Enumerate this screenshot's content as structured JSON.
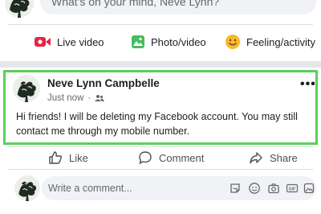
{
  "composer": {
    "placeholder": "What's on your mind, Neve Lynn?",
    "actions": [
      {
        "label": "Live video",
        "icon": "live-video-icon",
        "color": "#e42645"
      },
      {
        "label": "Photo/video",
        "icon": "photo-icon",
        "color": "#45bd62"
      },
      {
        "label": "Feeling/activity",
        "icon": "feeling-icon",
        "color": "#f7b928"
      }
    ]
  },
  "post": {
    "author": "Neve Lynn Campbelle",
    "time": "Just now",
    "dot": "·",
    "audience_icon": "friends-audience-icon",
    "body": "Hi friends! I will be deleting my Facebook account. You may still contact me through my mobile number.",
    "more": "•••",
    "highlight_color": "#5ad05a"
  },
  "reactions": [
    {
      "label": "Like",
      "icon": "like-icon"
    },
    {
      "label": "Comment",
      "icon": "comment-icon"
    },
    {
      "label": "Share",
      "icon": "share-icon"
    }
  ],
  "comment": {
    "placeholder": "Write a comment...",
    "icons": [
      "sticker-icon",
      "emoji-icon",
      "camera-icon",
      "gif-icon",
      "photo-sticker-icon"
    ]
  }
}
